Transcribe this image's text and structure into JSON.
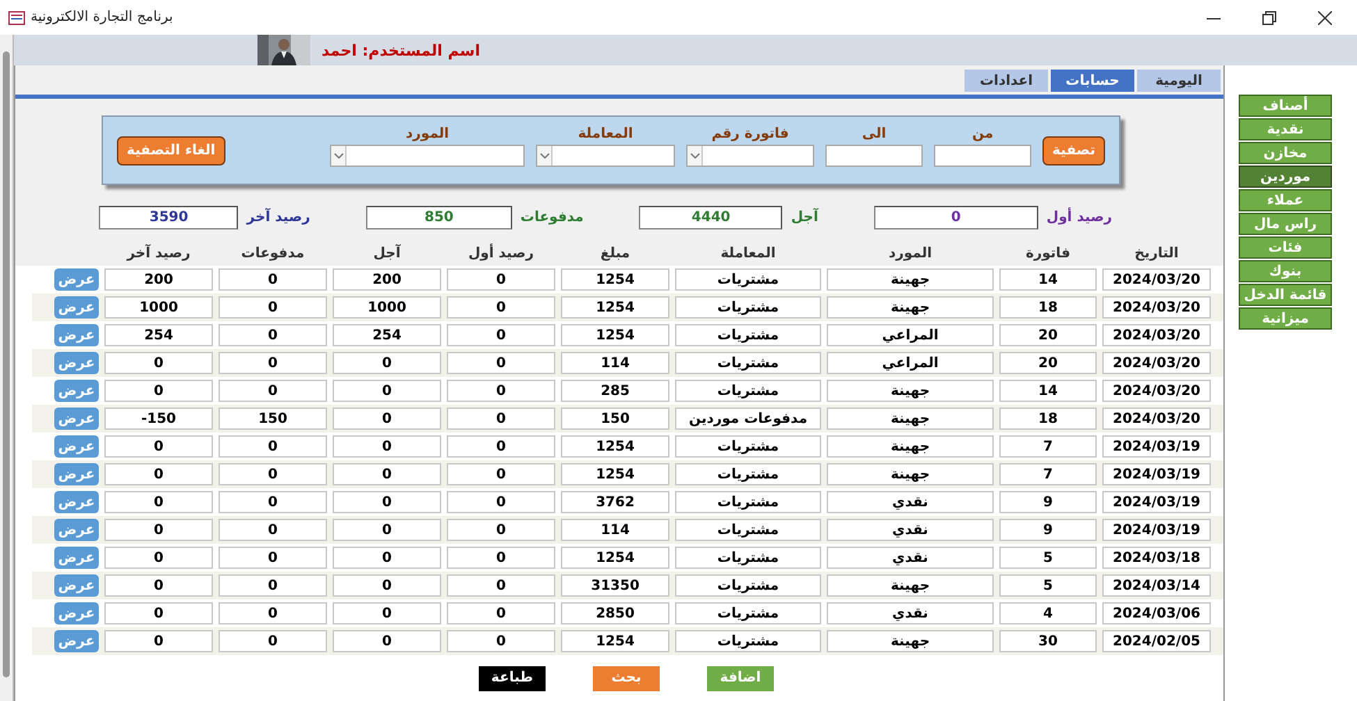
{
  "window": {
    "title": "برنامج التجارة الالكترونية"
  },
  "user": {
    "label": "اسم المستخدم: احمد"
  },
  "tabs": [
    {
      "label": "اليومية",
      "selected": false
    },
    {
      "label": "حسابات",
      "selected": true
    },
    {
      "label": "اعدادات",
      "selected": false
    }
  ],
  "filter": {
    "apply_button": "تصفية",
    "clear_button": "الغاء التصفية",
    "fields": [
      {
        "label": "من",
        "kind": "text"
      },
      {
        "label": "الى",
        "kind": "text"
      },
      {
        "label": "فاتورة رقم",
        "kind": "select"
      },
      {
        "label": "المعاملة",
        "kind": "select"
      },
      {
        "label": "المورد",
        "kind": "select"
      }
    ]
  },
  "summary": [
    {
      "label": "رصيد أول",
      "value": "0",
      "color": "#7030a0"
    },
    {
      "label": "آجل",
      "value": "4440",
      "color": "#2e7d32"
    },
    {
      "label": "مدفوعات",
      "value": "850",
      "color": "#2e7d32"
    },
    {
      "label": "رصيد آخر",
      "value": "3590",
      "color": "#2f3699"
    }
  ],
  "table": {
    "columns": [
      "التاريخ",
      "فاتورة",
      "المورد",
      "المعاملة",
      "مبلغ",
      "رصيد أول",
      "آجل",
      "مدفوعات",
      "رصيد آخر"
    ],
    "rows": [
      {
        "cells": [
          "2024/03/20",
          "14",
          "جهينة",
          "مشتريات",
          "1254",
          "0",
          "200",
          "0",
          "200"
        ],
        "action": "عرض"
      },
      {
        "cells": [
          "2024/03/20",
          "18",
          "جهينة",
          "مشتريات",
          "1254",
          "0",
          "1000",
          "0",
          "1000"
        ],
        "action": "عرض"
      },
      {
        "cells": [
          "2024/03/20",
          "20",
          "المراعي",
          "مشتريات",
          "1254",
          "0",
          "254",
          "0",
          "254"
        ],
        "action": "عرض"
      },
      {
        "cells": [
          "2024/03/20",
          "20",
          "المراعي",
          "مشتريات",
          "114",
          "0",
          "0",
          "0",
          "0"
        ],
        "action": "عرض"
      },
      {
        "cells": [
          "2024/03/20",
          "14",
          "جهينة",
          "مشتريات",
          "285",
          "0",
          "0",
          "0",
          "0"
        ],
        "action": "عرض"
      },
      {
        "cells": [
          "2024/03/20",
          "18",
          "جهينة",
          "مدفوعات موردين",
          "150",
          "0",
          "0",
          "150",
          "150-"
        ],
        "action": "عرض"
      },
      {
        "cells": [
          "2024/03/19",
          "7",
          "جهينة",
          "مشتريات",
          "1254",
          "0",
          "0",
          "0",
          "0"
        ],
        "action": "عرض"
      },
      {
        "cells": [
          "2024/03/19",
          "7",
          "جهينة",
          "مشتريات",
          "1254",
          "0",
          "0",
          "0",
          "0"
        ],
        "action": "عرض"
      },
      {
        "cells": [
          "2024/03/19",
          "9",
          "نقدي",
          "مشتريات",
          "3762",
          "0",
          "0",
          "0",
          "0"
        ],
        "action": "عرض"
      },
      {
        "cells": [
          "2024/03/19",
          "9",
          "نقدي",
          "مشتريات",
          "114",
          "0",
          "0",
          "0",
          "0"
        ],
        "action": "عرض"
      },
      {
        "cells": [
          "2024/03/18",
          "5",
          "نقدي",
          "مشتريات",
          "1254",
          "0",
          "0",
          "0",
          "0"
        ],
        "action": "عرض"
      },
      {
        "cells": [
          "2024/03/14",
          "5",
          "جهينة",
          "مشتريات",
          "31350",
          "0",
          "0",
          "0",
          "0"
        ],
        "action": "عرض"
      },
      {
        "cells": [
          "2024/03/06",
          "4",
          "نقدي",
          "مشتريات",
          "2850",
          "0",
          "0",
          "0",
          "0"
        ],
        "action": "عرض"
      },
      {
        "cells": [
          "2024/02/05",
          "30",
          "جهينة",
          "مشتريات",
          "1254",
          "0",
          "0",
          "0",
          "0"
        ],
        "action": "عرض"
      }
    ]
  },
  "actions": [
    {
      "label": "اضافة",
      "color": "#70ad47"
    },
    {
      "label": "بحث",
      "color": "#ed7d31"
    },
    {
      "label": "طباعة",
      "color": "#000000"
    }
  ],
  "sidebar": {
    "items": [
      {
        "label": "أصناف",
        "selected": false
      },
      {
        "label": "نقدية",
        "selected": false
      },
      {
        "label": "مخازن",
        "selected": false
      },
      {
        "label": "موردين",
        "selected": true
      },
      {
        "label": "عملاء",
        "selected": false
      },
      {
        "label": "راس مال",
        "selected": false
      },
      {
        "label": "فئات",
        "selected": false
      },
      {
        "label": "بنوك",
        "selected": false
      },
      {
        "label": "قائمة الدخل",
        "selected": false
      },
      {
        "label": "ميزانية",
        "selected": false
      }
    ]
  }
}
